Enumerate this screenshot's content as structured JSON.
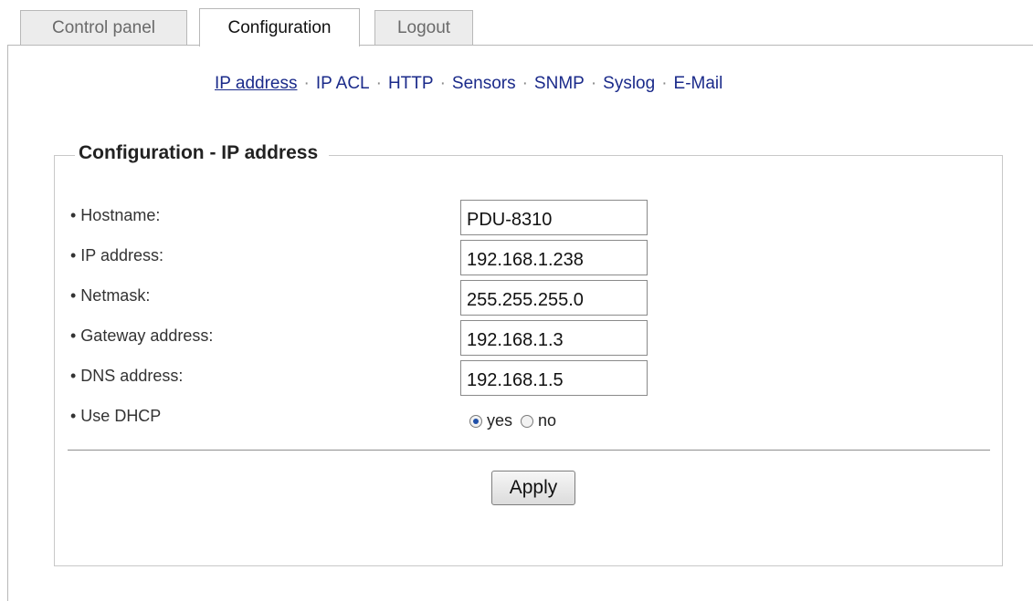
{
  "tabs": [
    {
      "label": "Control panel",
      "active": false
    },
    {
      "label": "Configuration",
      "active": true
    },
    {
      "label": "Logout",
      "active": false
    }
  ],
  "submenu": {
    "items": [
      "IP address",
      "IP ACL",
      "HTTP",
      "Sensors",
      "SNMP",
      "Syslog",
      "E-Mail"
    ],
    "current": "IP address",
    "separator": "·"
  },
  "section": {
    "title": "Configuration - IP address"
  },
  "fields": [
    {
      "label": "• Hostname:",
      "value": "PDU-8310"
    },
    {
      "label": "• IP address:",
      "value": "192.168.1.238"
    },
    {
      "label": "• Netmask:",
      "value": "255.255.255.0"
    },
    {
      "label": "• Gateway address:",
      "value": "192.168.1.3"
    },
    {
      "label": "• DNS address:",
      "value": "192.168.1.5"
    }
  ],
  "dhcp": {
    "label": "• Use DHCP",
    "options": [
      "yes",
      "no"
    ],
    "selected": "yes"
  },
  "apply_label": "Apply",
  "colors": {
    "link": "#1a2a8a",
    "radio_checked": "#1f4fa8",
    "border": "#b8b8b8"
  }
}
